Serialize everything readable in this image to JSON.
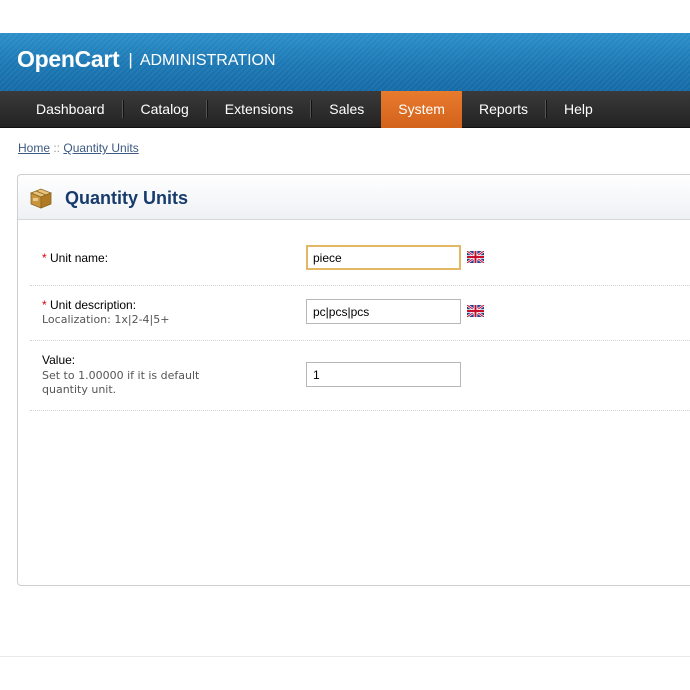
{
  "header": {
    "brand": "OpenCart",
    "separator": "|",
    "subtitle": "ADMINISTRATION"
  },
  "menu": {
    "items": [
      {
        "label": "Dashboard",
        "active": false
      },
      {
        "label": "Catalog",
        "active": false
      },
      {
        "label": "Extensions",
        "active": false
      },
      {
        "label": "Sales",
        "active": false
      },
      {
        "label": "System",
        "active": true
      },
      {
        "label": "Reports",
        "active": false
      },
      {
        "label": "Help",
        "active": false
      }
    ]
  },
  "breadcrumb": {
    "home": "Home",
    "separator": " :: ",
    "current": "Quantity Units"
  },
  "box": {
    "title": "Quantity Units",
    "icon": "box-icon"
  },
  "form": {
    "unit_name": {
      "required_mark": "*",
      "label": "Unit name:",
      "value": "piece",
      "flag_icon": "uk-flag-icon"
    },
    "unit_description": {
      "required_mark": "*",
      "label": "Unit description:",
      "help": "Localization: 1x|2-4|5+",
      "value": "pc|pcs|pcs",
      "flag_icon": "uk-flag-icon"
    },
    "value": {
      "label": "Value:",
      "help_line1": "Set to 1.00000 if it is default",
      "help_line2": "quantity unit.",
      "value": "1"
    }
  },
  "colors": {
    "header_blue": "#1b77b3",
    "menu_dark": "#2a2a2a",
    "active_orange": "#d3621b",
    "title_navy": "#173b6d",
    "required_red": "#e00000"
  }
}
